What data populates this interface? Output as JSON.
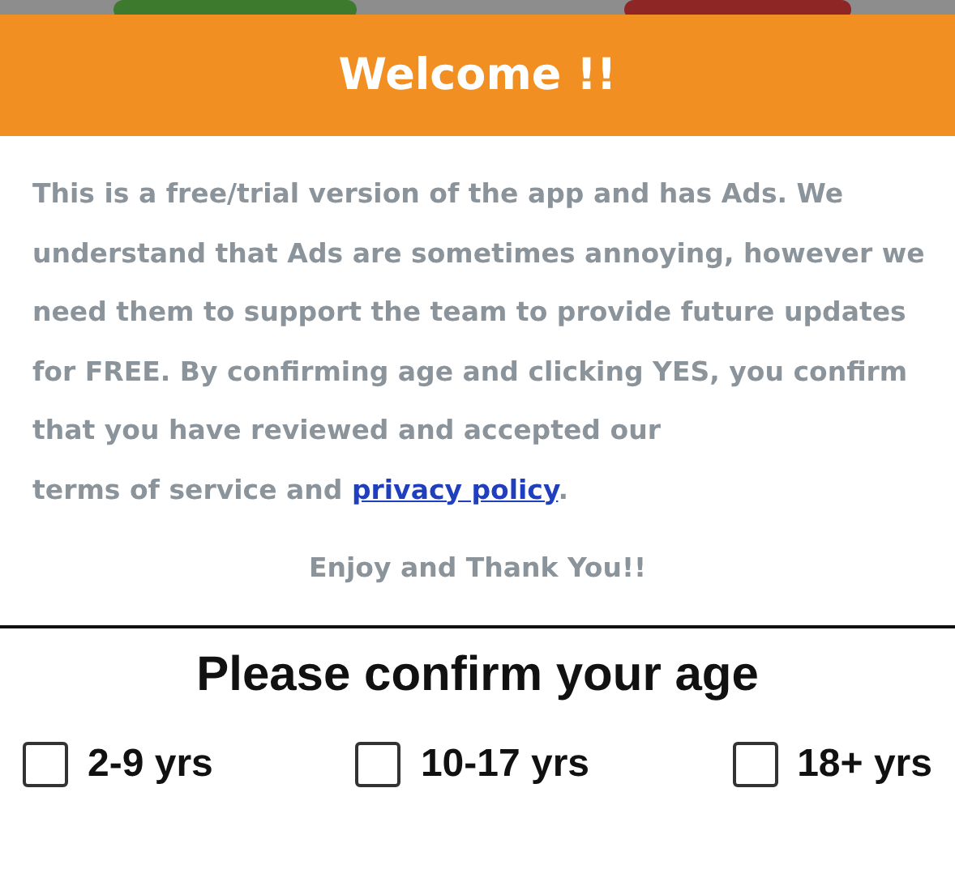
{
  "header": {
    "title": "Welcome !!"
  },
  "message": {
    "text": "This is a free/trial version of the app and has Ads. We understand that Ads are sometimes annoying, however we need them to support the team to provide future updates for FREE. By confirming age and clicking YES, you confirm that you have reviewed and accepted our",
    "terms_prefix": "terms of service and",
    "link": "privacy policy",
    "suffix": "."
  },
  "thanks": "Enjoy and Thank You!!",
  "age": {
    "title": "Please confirm your age",
    "options": [
      {
        "label": "2-9 yrs",
        "checked": false
      },
      {
        "label": "10-17 yrs",
        "checked": false
      },
      {
        "label": "18+ yrs",
        "checked": false
      }
    ]
  }
}
